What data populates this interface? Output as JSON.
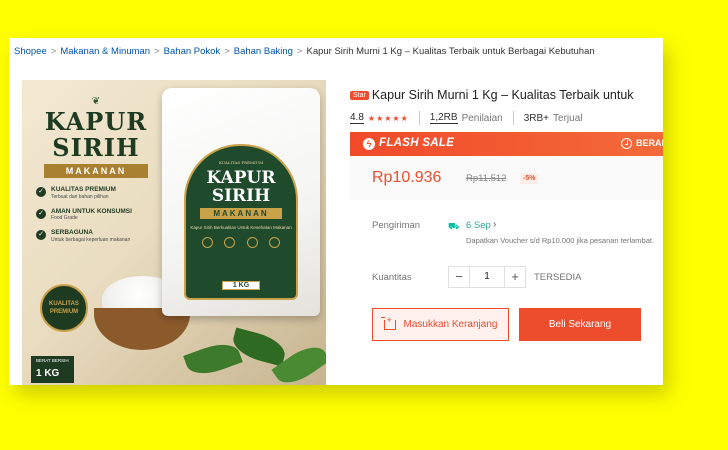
{
  "breadcrumb": {
    "items": [
      "Shopee",
      "Makanan & Minuman",
      "Bahan Pokok",
      "Bahan Baking"
    ],
    "current": "Kapur Sirih Murni 1 Kg – Kualitas Terbaik untuk Berbagai Kebutuhan"
  },
  "product_image": {
    "title_line1": "KAPUR",
    "title_line2": "SIRIH",
    "band": "MAKANAN",
    "features": [
      {
        "title": "KUALITAS PREMIUM",
        "sub": "Terbuat dari bahan pilihan"
      },
      {
        "title": "AMAN UNTUK KONSUMSI",
        "sub": "Food Grade"
      },
      {
        "title": "SERBAGUNA",
        "sub": "Untuk berbagai keperluan makanan"
      }
    ],
    "badge": "KUALITAS PREMIUM",
    "berat_label": "BERAT BERSIH",
    "berat_value": "1 KG",
    "bag": {
      "top_text": "KUALITAS PREMIUM",
      "title_line1": "KAPUR",
      "title_line2": "SIRIH",
      "band": "MAKANAN",
      "subtitle": "Kapur Sirih Berkualitas Untuk Kesehatan Makanan",
      "weight": "1 KG"
    }
  },
  "product": {
    "badge": "Star",
    "title": "Kapur Sirih Murni 1 Kg – Kualitas Terbaik untuk",
    "rating": "4.8",
    "reviews_count": "1,2RB",
    "reviews_label": "Penilaian",
    "sold_count": "3RB+",
    "sold_label": "Terjual"
  },
  "flash_sale": {
    "label": "FLASH SALE",
    "ends_label": "BERAKHIR"
  },
  "price": {
    "current": "Rp10.936",
    "original": "Rp11.512",
    "discount": "-5%"
  },
  "shipping": {
    "label": "Pengiriman",
    "date": "6 Sep",
    "voucher_text": "Dapatkan Voucher s/d Rp10.000 jika pesanan terlambat."
  },
  "quantity": {
    "label": "Kuantitas",
    "value": "1",
    "minus": "−",
    "plus": "+",
    "stock_label": "TERSEDIA"
  },
  "buttons": {
    "add_to_cart": "Masukkan Keranjang",
    "buy_now": "Beli Sekarang"
  },
  "colors": {
    "accent": "#ee4d2d",
    "background": "#ffff00"
  }
}
